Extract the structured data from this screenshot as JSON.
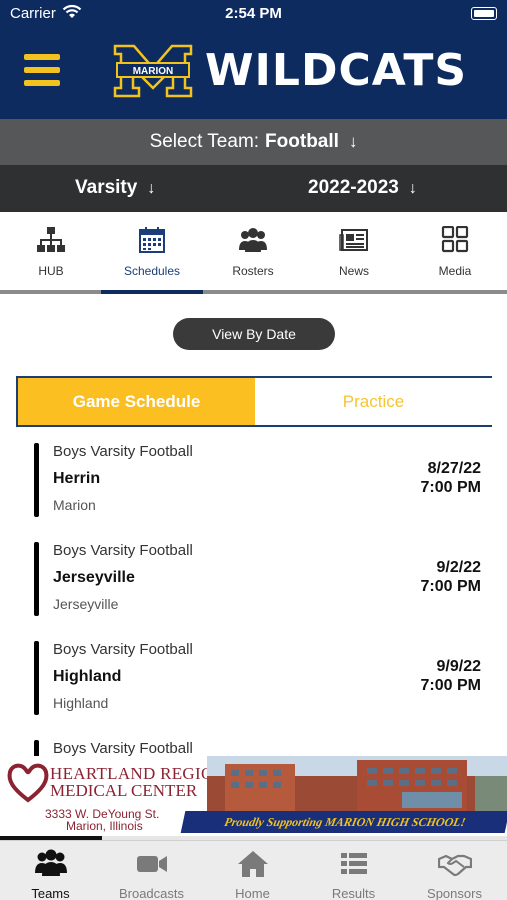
{
  "status_bar": {
    "carrier": "Carrier",
    "time": "2:54 PM"
  },
  "header": {
    "team_name": "WILDCATS",
    "logo_text": "MARION"
  },
  "team_selector": {
    "label": "Select Team:",
    "value": "Football"
  },
  "filters": {
    "level": "Varsity",
    "season": "2022-2023"
  },
  "top_tabs": [
    {
      "label": "HUB",
      "icon": "hierarchy-icon"
    },
    {
      "label": "Schedules",
      "icon": "calendar-icon",
      "active": true
    },
    {
      "label": "Rosters",
      "icon": "group-icon"
    },
    {
      "label": "News",
      "icon": "newspaper-icon"
    },
    {
      "label": "Media",
      "icon": "grid-icon"
    }
  ],
  "view_by_date_label": "View By Date",
  "segments": {
    "left": "Game Schedule",
    "right": "Practice"
  },
  "games": [
    {
      "team": "Boys Varsity Football",
      "opponent": "Herrin",
      "location": "Marion",
      "date": "8/27/22",
      "time": "7:00 PM"
    },
    {
      "team": "Boys Varsity Football",
      "opponent": "Jerseyville",
      "location": "Jerseyville",
      "date": "9/2/22",
      "time": "7:00 PM"
    },
    {
      "team": "Boys Varsity Football",
      "opponent": "Highland",
      "location": "Highland",
      "date": "9/9/22",
      "time": "7:00 PM"
    },
    {
      "team": "Boys Varsity Football"
    }
  ],
  "sponsor": {
    "name_line1": "Heartland Regional",
    "name_line2": "Medical Center",
    "address_line1": "3333 W. DeYoung St.",
    "address_line2": "Marion, Illinois",
    "tagline": "Proudly Supporting MARION HIGH SCHOOL!",
    "brand_color": "#8b2332"
  },
  "bottom_tabs": [
    {
      "label": "Teams",
      "icon": "team-icon",
      "active": true
    },
    {
      "label": "Broadcasts",
      "icon": "video-camera-icon"
    },
    {
      "label": "Home",
      "icon": "house-icon"
    },
    {
      "label": "Results",
      "icon": "list-icon"
    },
    {
      "label": "Sponsors",
      "icon": "handshake-icon"
    }
  ],
  "colors": {
    "navy": "#0d2b5e",
    "gold": "#fbbf22",
    "accent_gold": "#f2c31e"
  }
}
